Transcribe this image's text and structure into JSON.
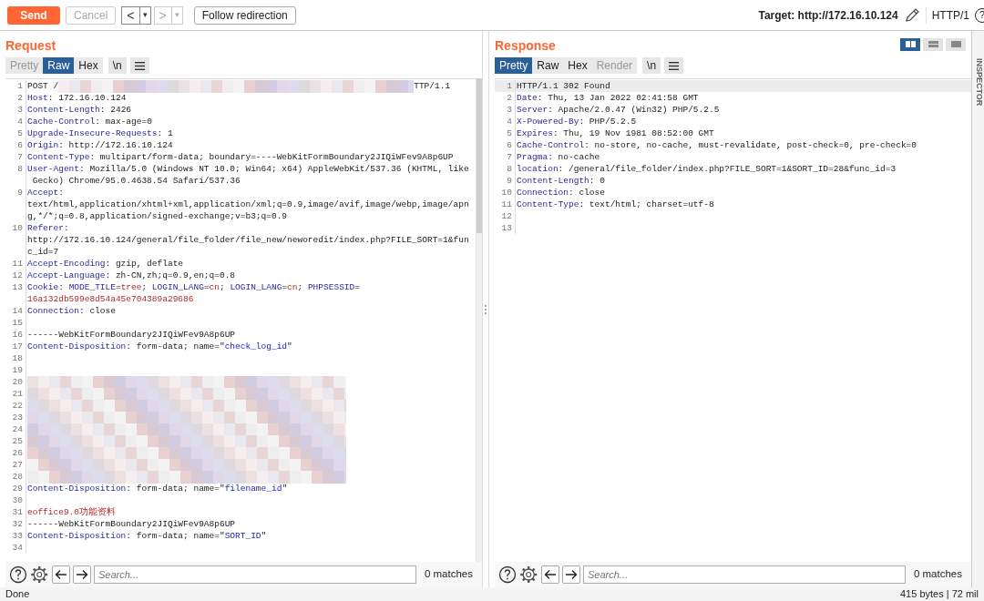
{
  "toolbar": {
    "send": "Send",
    "cancel": {
      "label": "Cancel",
      "disabled": true
    },
    "back": {
      "label": "<",
      "menu": "▾",
      "disabled": false
    },
    "forward": {
      "label": ">",
      "menu": "▾",
      "disabled": true
    },
    "follow": "Follow redirection",
    "target_label": "Target:",
    "target": "http://172.16.10.124",
    "protocol": "HTTP/1",
    "help": "?"
  },
  "request": {
    "title": "Request",
    "tabs": [
      {
        "label": "Pretty",
        "selected": false,
        "disabled": true
      },
      {
        "label": "Raw",
        "selected": true,
        "disabled": false
      },
      {
        "label": "Hex",
        "selected": false,
        "disabled": false
      }
    ],
    "newline_toggle": "\\n",
    "lines": [
      {
        "no": "1",
        "current": false,
        "rows": [
          [
            {
              "kind": "text",
              "text": "POST /"
            },
            {
              "kind": "redacted"
            },
            {
              "kind": "text",
              "text": "TTP/1.1"
            }
          ]
        ]
      },
      {
        "no": "2",
        "current": false,
        "rows": [
          [
            {
              "kind": "name",
              "text": "Host"
            },
            {
              "kind": "text",
              "text": ": 172.16.10.124"
            }
          ]
        ]
      },
      {
        "no": "3",
        "current": false,
        "rows": [
          [
            {
              "kind": "name",
              "text": "Content-Length"
            },
            {
              "kind": "text",
              "text": ": 2426"
            }
          ]
        ]
      },
      {
        "no": "4",
        "current": false,
        "rows": [
          [
            {
              "kind": "name",
              "text": "Cache-Control"
            },
            {
              "kind": "text",
              "text": ": max-age=0"
            }
          ]
        ]
      },
      {
        "no": "5",
        "current": false,
        "rows": [
          [
            {
              "kind": "name",
              "text": "Upgrade-Insecure-Requests"
            },
            {
              "kind": "text",
              "text": ": 1"
            }
          ]
        ]
      },
      {
        "no": "6",
        "current": false,
        "rows": [
          [
            {
              "kind": "name",
              "text": "Origin"
            },
            {
              "kind": "text",
              "text": ": http://172.16.10.124"
            }
          ]
        ]
      },
      {
        "no": "7",
        "current": false,
        "rows": [
          [
            {
              "kind": "name",
              "text": "Content-Type"
            },
            {
              "kind": "text",
              "text": ": multipart/form-data; boundary=----WebKitFormBoundary2JIQiWFev9A8p6UP"
            }
          ]
        ]
      },
      {
        "no": "8",
        "current": false,
        "rows": [
          [
            {
              "kind": "name",
              "text": "User-Agent"
            },
            {
              "kind": "text",
              "text": ": Mozilla/5.0 (Windows NT 10.0; Win64; x64) AppleWebKit/537.36 (KHTML, like"
            }
          ],
          [
            {
              "kind": "text",
              "text": " Gecko) Chrome/95.0.4638.54 Safari/537.36"
            }
          ]
        ]
      },
      {
        "no": "9",
        "current": false,
        "rows": [
          [
            {
              "kind": "name",
              "text": "Accept"
            },
            {
              "kind": "text",
              "text": ":"
            }
          ],
          [
            {
              "kind": "text",
              "text": "text/html,application/xhtml+xml,application/xml;q=0.9,image/avif,image/webp,image/apn"
            }
          ],
          [
            {
              "kind": "text",
              "text": "g,*/*;q=0.8,application/signed-exchange;v=b3;q=0.9"
            }
          ]
        ]
      },
      {
        "no": "10",
        "current": false,
        "rows": [
          [
            {
              "kind": "name",
              "text": "Referer"
            },
            {
              "kind": "text",
              "text": ":"
            }
          ],
          [
            {
              "kind": "text",
              "text": "http://172.16.10.124/general/file_folder/file_new/neworedit/index.php?FILE_SORT=1&fun"
            }
          ],
          [
            {
              "kind": "text",
              "text": "c_id=7"
            }
          ]
        ]
      },
      {
        "no": "11",
        "current": false,
        "rows": [
          [
            {
              "kind": "name",
              "text": "Accept-Encoding"
            },
            {
              "kind": "text",
              "text": ": gzip, deflate"
            }
          ]
        ]
      },
      {
        "no": "12",
        "current": false,
        "rows": [
          [
            {
              "kind": "name",
              "text": "Accept-Language"
            },
            {
              "kind": "text",
              "text": ": zh-CN,zh;q=0.9,en;q=0.8"
            }
          ]
        ]
      },
      {
        "no": "13",
        "current": false,
        "rows": [
          [
            {
              "kind": "name",
              "text": "Cookie"
            },
            {
              "kind": "text",
              "text": ": "
            },
            {
              "kind": "name",
              "text": "MODE_TILE"
            },
            {
              "kind": "text",
              "text": "="
            },
            {
              "kind": "red",
              "text": "tree"
            },
            {
              "kind": "text",
              "text": "; "
            },
            {
              "kind": "name",
              "text": "LOGIN_LANG"
            },
            {
              "kind": "text",
              "text": "="
            },
            {
              "kind": "red",
              "text": "cn"
            },
            {
              "kind": "text",
              "text": "; "
            },
            {
              "kind": "name",
              "text": "LOGIN_LANG"
            },
            {
              "kind": "text",
              "text": "="
            },
            {
              "kind": "red",
              "text": "cn"
            },
            {
              "kind": "text",
              "text": "; "
            },
            {
              "kind": "name",
              "text": "PHPSESSID"
            },
            {
              "kind": "text",
              "text": "="
            }
          ],
          [
            {
              "kind": "red",
              "text": "16a132db599e8d54a45e704389a29686"
            }
          ]
        ]
      },
      {
        "no": "14",
        "current": false,
        "rows": [
          [
            {
              "kind": "name",
              "text": "Connection"
            },
            {
              "kind": "text",
              "text": ": close"
            }
          ]
        ]
      },
      {
        "no": "15",
        "current": false,
        "rows": [
          []
        ]
      },
      {
        "no": "16",
        "current": false,
        "rows": [
          [
            {
              "kind": "text",
              "text": "------WebKitFormBoundary2JIQiWFev9A8p6UP"
            }
          ]
        ]
      },
      {
        "no": "17",
        "current": false,
        "rows": [
          [
            {
              "kind": "name",
              "text": "Content-Disposition"
            },
            {
              "kind": "text",
              "text": ": form-data; name=\""
            },
            {
              "kind": "blue",
              "text": "check_log_id"
            },
            {
              "kind": "text",
              "text": "\""
            }
          ]
        ]
      },
      {
        "no": "18",
        "current": false,
        "rows": [
          []
        ]
      },
      {
        "no": "19",
        "current": false,
        "rows": [
          []
        ]
      },
      {
        "no": "20",
        "current": false,
        "rows": [
          [
            {
              "kind": "redacted"
            }
          ]
        ]
      },
      {
        "no": "21",
        "current": false,
        "rows": [
          [
            {
              "kind": "redacted"
            }
          ]
        ]
      },
      {
        "no": "22",
        "current": false,
        "rows": [
          [
            {
              "kind": "redacted"
            }
          ]
        ]
      },
      {
        "no": "23",
        "current": false,
        "rows": [
          [
            {
              "kind": "redacted"
            }
          ]
        ]
      },
      {
        "no": "24",
        "current": false,
        "rows": [
          [
            {
              "kind": "redacted"
            }
          ]
        ]
      },
      {
        "no": "25",
        "current": false,
        "rows": [
          [
            {
              "kind": "redacted"
            }
          ]
        ]
      },
      {
        "no": "26",
        "current": false,
        "rows": [
          [
            {
              "kind": "redacted"
            }
          ]
        ]
      },
      {
        "no": "27",
        "current": false,
        "rows": [
          [
            {
              "kind": "redacted"
            }
          ]
        ]
      },
      {
        "no": "28",
        "current": false,
        "rows": [
          [
            {
              "kind": "redacted"
            }
          ]
        ]
      },
      {
        "no": "29",
        "current": false,
        "rows": [
          [
            {
              "kind": "name",
              "text": "Content-Disposition"
            },
            {
              "kind": "text",
              "text": ": form-data; name=\""
            },
            {
              "kind": "blue",
              "text": "filename_id"
            },
            {
              "kind": "text",
              "text": "\""
            }
          ]
        ]
      },
      {
        "no": "30",
        "current": false,
        "rows": [
          []
        ]
      },
      {
        "no": "31",
        "current": false,
        "rows": [
          [
            {
              "kind": "red",
              "text": "eoffice9.0功能资料"
            }
          ]
        ]
      },
      {
        "no": "32",
        "current": false,
        "rows": [
          [
            {
              "kind": "text",
              "text": "------WebKitFormBoundary2JIQiWFev9A8p6UP"
            }
          ]
        ]
      },
      {
        "no": "33",
        "current": false,
        "rows": [
          [
            {
              "kind": "name",
              "text": "Content-Disposition"
            },
            {
              "kind": "text",
              "text": ": form-data; name=\""
            },
            {
              "kind": "blue",
              "text": "SORT_ID"
            },
            {
              "kind": "text",
              "text": "\""
            }
          ]
        ]
      },
      {
        "no": "34",
        "current": false,
        "rows": [
          []
        ]
      }
    ],
    "search": {
      "placeholder": "Search...",
      "matches": "0 matches"
    }
  },
  "response": {
    "title": "Response",
    "tabs": [
      {
        "label": "Pretty",
        "selected": true,
        "disabled": false
      },
      {
        "label": "Raw",
        "selected": false,
        "disabled": false
      },
      {
        "label": "Hex",
        "selected": false,
        "disabled": false
      },
      {
        "label": "Render",
        "selected": false,
        "disabled": true
      }
    ],
    "newline_toggle": "\\n",
    "layouts": [
      {
        "selected": true
      },
      {
        "selected": false
      },
      {
        "selected": false
      }
    ],
    "lines": [
      {
        "no": "1",
        "current": true,
        "rows": [
          [
            {
              "kind": "text",
              "text": "HTTP/1.1 302 Found"
            }
          ]
        ]
      },
      {
        "no": "2",
        "current": false,
        "rows": [
          [
            {
              "kind": "name",
              "text": "Date"
            },
            {
              "kind": "text",
              "text": ": Thu, 13 Jan 2022 02:41:58 GMT"
            }
          ]
        ]
      },
      {
        "no": "3",
        "current": false,
        "rows": [
          [
            {
              "kind": "name",
              "text": "Server"
            },
            {
              "kind": "text",
              "text": ": Apache/2.0.47 (Win32) PHP/5.2.5"
            }
          ]
        ]
      },
      {
        "no": "4",
        "current": false,
        "rows": [
          [
            {
              "kind": "name",
              "text": "X-Powered-By"
            },
            {
              "kind": "text",
              "text": ": PHP/5.2.5"
            }
          ]
        ]
      },
      {
        "no": "5",
        "current": false,
        "rows": [
          [
            {
              "kind": "name",
              "text": "Expires"
            },
            {
              "kind": "text",
              "text": ": Thu, 19 Nov 1981 08:52:00 GMT"
            }
          ]
        ]
      },
      {
        "no": "6",
        "current": false,
        "rows": [
          [
            {
              "kind": "name",
              "text": "Cache-Control"
            },
            {
              "kind": "text",
              "text": ": no-store, no-cache, must-revalidate, post-check=0, pre-check=0"
            }
          ]
        ]
      },
      {
        "no": "7",
        "current": false,
        "rows": [
          [
            {
              "kind": "name",
              "text": "Pragma"
            },
            {
              "kind": "text",
              "text": ": no-cache"
            }
          ]
        ]
      },
      {
        "no": "8",
        "current": false,
        "rows": [
          [
            {
              "kind": "name",
              "text": "location"
            },
            {
              "kind": "text",
              "text": ": /general/file_folder/index.php?FILE_SORT=1&SORT_ID=28&func_id=3"
            }
          ]
        ]
      },
      {
        "no": "9",
        "current": false,
        "rows": [
          [
            {
              "kind": "name",
              "text": "Content-Length"
            },
            {
              "kind": "text",
              "text": ": 0"
            }
          ]
        ]
      },
      {
        "no": "10",
        "current": false,
        "rows": [
          [
            {
              "kind": "name",
              "text": "Connection"
            },
            {
              "kind": "text",
              "text": ": close"
            }
          ]
        ]
      },
      {
        "no": "11",
        "current": false,
        "rows": [
          [
            {
              "kind": "name",
              "text": "Content-Type"
            },
            {
              "kind": "text",
              "text": ": text/html; charset=utf-8"
            }
          ]
        ]
      },
      {
        "no": "12",
        "current": false,
        "rows": [
          []
        ]
      },
      {
        "no": "13",
        "current": false,
        "rows": [
          []
        ]
      }
    ],
    "search": {
      "placeholder": "Search...",
      "matches": "0 matches"
    }
  },
  "inspector": "INSPECTOR",
  "status_bar": {
    "left": "Done",
    "right": "415 bytes | 72 mil"
  }
}
